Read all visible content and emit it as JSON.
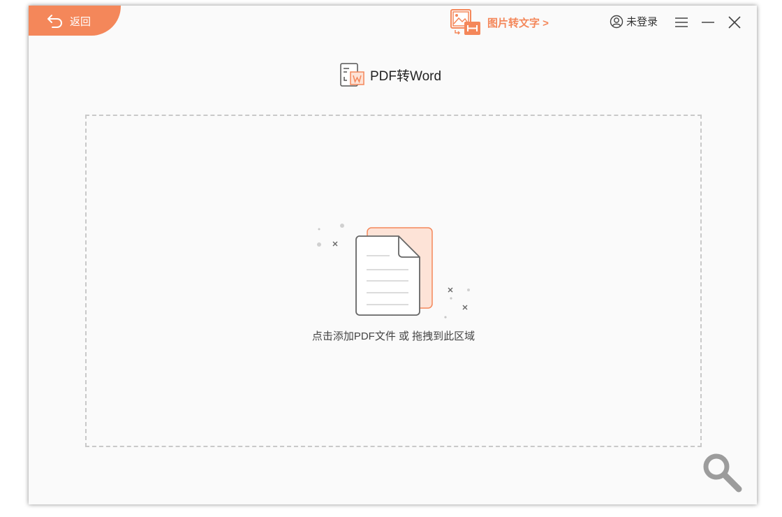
{
  "header": {
    "back_label": "返回",
    "promo_label": "图片转文字 >",
    "user_label": "未登录"
  },
  "main": {
    "title": "PDF转Word"
  },
  "dropzone": {
    "hint": "点击添加PDF文件 或 拖拽到此区域"
  },
  "colors": {
    "accent": "#f4875a",
    "accent_light": "#fde3d7",
    "border_dashed": "#c9c9c9",
    "background": "#fafafa"
  },
  "icons": {
    "back": "back-arrow-icon",
    "promo": "image-to-text-icon",
    "user": "user-icon",
    "menu": "hamburger-menu-icon",
    "minimize": "minimize-icon",
    "close": "close-icon",
    "title": "pdf-to-word-icon",
    "dropzone": "document-illustration-icon",
    "zoom": "magnifier-icon"
  }
}
